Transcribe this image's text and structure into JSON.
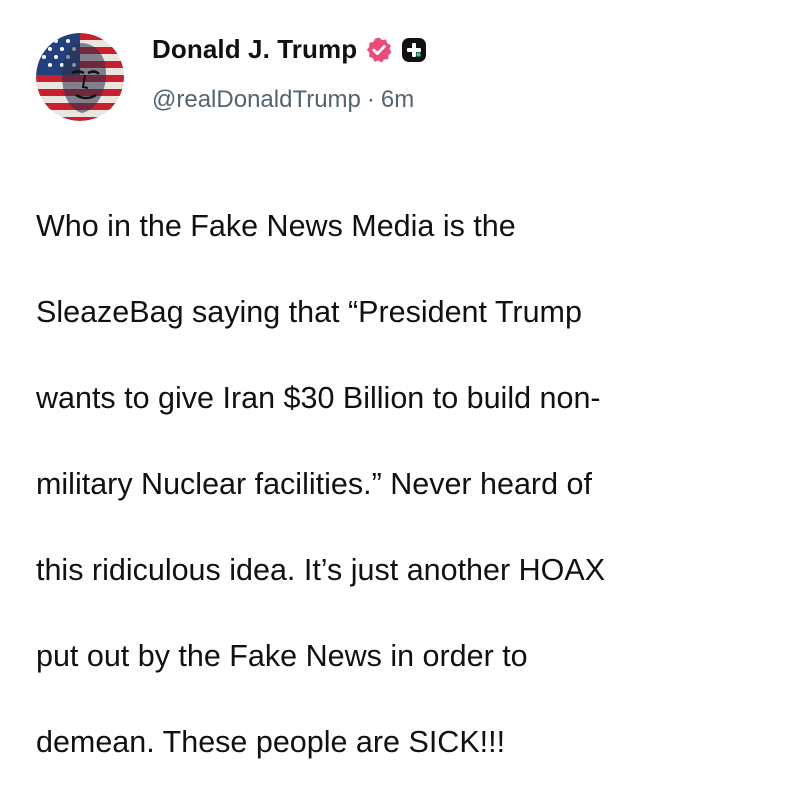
{
  "author": {
    "display_name": "Donald J. Trump",
    "handle": "@realDonaldTrump",
    "separator": "·",
    "timestamp": "6m",
    "avatar_icon": "flag-portrait-avatar",
    "verified_icon": "verified-badge-icon",
    "plus_icon": "plus-badge-icon"
  },
  "post": {
    "lines": [
      "Who in the Fake News Media is the",
      "SleazeBag saying that “President Trump",
      "wants to give Iran $30 Billion to build non-",
      "military Nuclear facilities.” Never heard of",
      "this ridiculous idea. It’s just another HOAX",
      "put out by the Fake News in order to",
      "demean. These people are SICK!!!"
    ]
  },
  "colors": {
    "verified_badge": "#e94b7a",
    "plus_badge": "#111111",
    "meta_text": "#536471",
    "body_text": "#111111"
  }
}
